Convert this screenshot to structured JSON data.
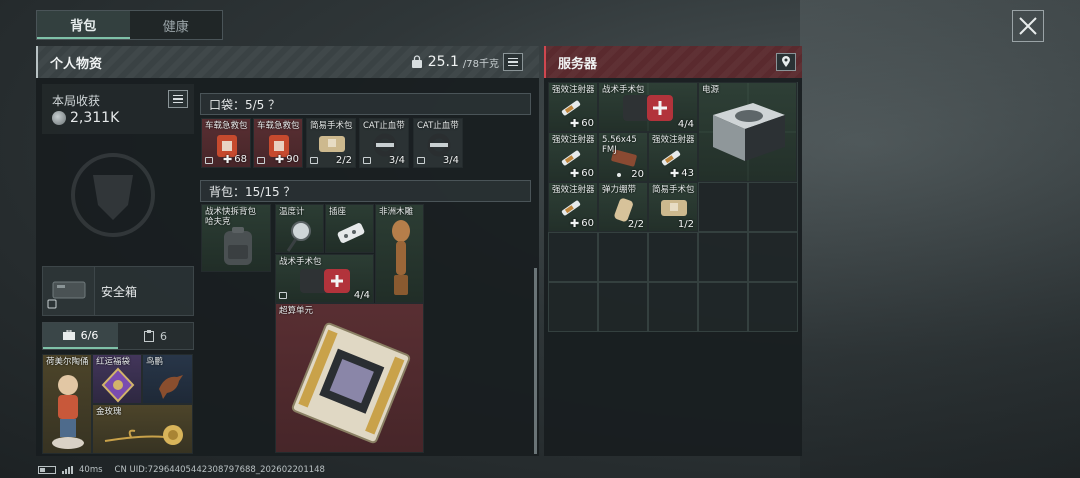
{
  "tabs": [
    {
      "label": "背包",
      "active": true
    },
    {
      "label": "健康",
      "active": false
    }
  ],
  "personal": {
    "title": "个人物资",
    "weight_current": "25.1",
    "weight_max": "/78千克"
  },
  "earnings": {
    "label": "本局收获",
    "value": "2,311K"
  },
  "safe_box": {
    "label": "安全箱"
  },
  "subtabs": [
    {
      "label": "6/6",
      "icon": "briefcase-icon",
      "active": true
    },
    {
      "label": "6",
      "icon": "clipboard-icon",
      "active": false
    }
  ],
  "safe_items": [
    {
      "name": "荷美尔陶俑",
      "rarity": "gold",
      "icon": "figurine-icon"
    },
    {
      "name": "红运福袋",
      "rarity": "purple",
      "icon": "lucky-bag-icon"
    },
    {
      "name": "鸟鹏",
      "rarity": "blue",
      "icon": "bird-statue-icon"
    },
    {
      "name": "金玫瑰",
      "rarity": "gold",
      "icon": "golden-rose-icon"
    }
  ],
  "pocket": {
    "title": "口袋：5/5 ？",
    "items": [
      {
        "name": "车载急救包",
        "count": "68",
        "kind": "heal",
        "icon": "first-aid-kit-icon"
      },
      {
        "name": "车载急救包",
        "count": "90",
        "kind": "heal",
        "icon": "first-aid-kit-icon"
      },
      {
        "name": "简易手术包",
        "count": "2/2",
        "kind": "plain",
        "icon": "surgical-kit-icon"
      },
      {
        "name": "CAT止血带",
        "count": "3/4",
        "kind": "plain",
        "icon": "tourniquet-icon"
      },
      {
        "name": "CAT止血带",
        "count": "3/4",
        "kind": "plain",
        "icon": "tourniquet-icon"
      }
    ]
  },
  "backpack": {
    "title": "背包：15/15 ？",
    "items": [
      {
        "name": "战术快拆背包 哈夫克",
        "count": "",
        "rarity": "green",
        "icon": "backpack-icon"
      },
      {
        "name": "温度计",
        "count": "",
        "rarity": "green",
        "icon": "thermometer-icon"
      },
      {
        "name": "插座",
        "count": "",
        "rarity": "green",
        "icon": "power-strip-icon"
      },
      {
        "name": "非洲木雕",
        "count": "",
        "rarity": "green",
        "icon": "wood-carving-icon"
      },
      {
        "name": "战术手术包",
        "count": "4/4",
        "rarity": "green",
        "icon": "tactical-surgery-kit-icon"
      },
      {
        "name": "超算单元",
        "count": "",
        "rarity": "red",
        "icon": "supercomputer-unit-icon"
      }
    ]
  },
  "server": {
    "title": "服务器",
    "items": [
      {
        "name": "强效注射器",
        "count": "60",
        "kind": "heal",
        "icon": "syringe-icon"
      },
      {
        "name": "战术手术包",
        "count": "4/4",
        "kind": "plain",
        "icon": "tactical-surgery-kit-icon"
      },
      {
        "name": "电源",
        "count": "",
        "kind": "plain",
        "icon": "power-supply-icon"
      },
      {
        "name": "强效注射器",
        "count": "60",
        "kind": "heal",
        "icon": "syringe-icon"
      },
      {
        "name": "5.56x45 FMJ",
        "count": "20",
        "kind": "ammo",
        "icon": "ammo-box-icon"
      },
      {
        "name": "强效注射器",
        "count": "43",
        "kind": "heal",
        "icon": "syringe-icon"
      },
      {
        "name": "强效注射器",
        "count": "60",
        "kind": "heal",
        "icon": "syringe-icon"
      },
      {
        "name": "弹力绷带",
        "count": "2/2",
        "kind": "plain",
        "icon": "elastic-bandage-icon"
      },
      {
        "name": "简易手术包",
        "count": "1/2",
        "kind": "plain",
        "icon": "surgical-kit-icon"
      }
    ]
  },
  "status_bar": {
    "ping": "40ms",
    "uid": "CN UID:7296440544230879768​8_202602201148"
  },
  "colors": {
    "accent": "#7fc1a8",
    "server_header": "#5a2a2e",
    "server_border": "#d0474f"
  }
}
